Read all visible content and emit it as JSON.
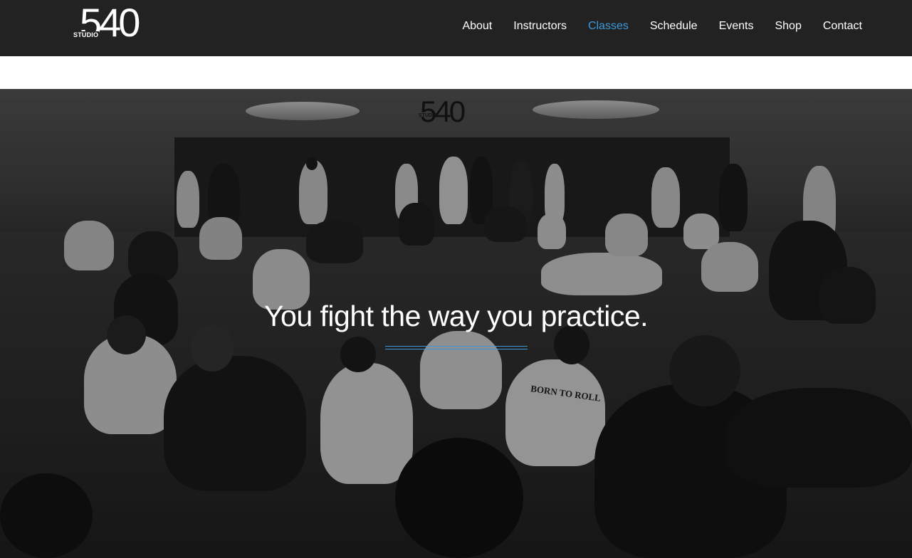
{
  "brand": {
    "logo_number": "540",
    "logo_word": "STUDIO"
  },
  "nav": {
    "items": [
      {
        "label": "About",
        "active": false
      },
      {
        "label": "Instructors",
        "active": false
      },
      {
        "label": "Classes",
        "active": true
      },
      {
        "label": "Schedule",
        "active": false
      },
      {
        "label": "Events",
        "active": false
      },
      {
        "label": "Shop",
        "active": false
      },
      {
        "label": "Contact",
        "active": false
      }
    ]
  },
  "hero": {
    "tagline": "You fight the way you practice.",
    "wall_logo_number": "540",
    "wall_logo_word": "STUDIO",
    "patch_text": "BORN TO ROLL"
  },
  "colors": {
    "nav_background": "#222222",
    "accent": "#3a9ad9",
    "text": "#ffffff"
  }
}
